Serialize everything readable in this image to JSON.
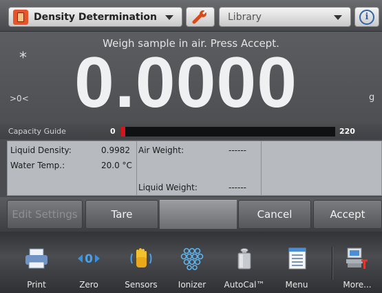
{
  "header": {
    "application": "Density Determination",
    "library_placeholder": "Library",
    "info_glyph": "i"
  },
  "display": {
    "prompt": "Weigh sample in air. Press Accept.",
    "stable_indicator": "*",
    "zero_indicator": ">0<",
    "weight": "0.0000",
    "unit": "g"
  },
  "capacity": {
    "label": "Capacity Guide",
    "min": "0",
    "max": "220",
    "fill_fraction": 0.02,
    "fill_color": "#d8141a"
  },
  "info": {
    "liquid_density_label": "Liquid Density:",
    "liquid_density_value": "0.9982",
    "water_temp_label": "Water Temp.:",
    "water_temp_value": "20.0 °C",
    "air_weight_label": "Air Weight:",
    "air_weight_value": "------",
    "liquid_weight_label": "Liquid Weight:",
    "liquid_weight_value": "------"
  },
  "actions": {
    "edit_settings": "Edit Settings",
    "tare": "Tare",
    "cancel": "Cancel",
    "accept": "Accept"
  },
  "toolbar": [
    {
      "label": "Print",
      "icon": "printer-icon"
    },
    {
      "label": "Zero",
      "icon": "zero-icon"
    },
    {
      "label": "Sensors",
      "icon": "hand-sensor-icon"
    },
    {
      "label": "Ionizer",
      "icon": "ionizer-icon"
    },
    {
      "label": "AutoCal™",
      "icon": "calibration-weight-icon"
    },
    {
      "label": "Menu",
      "icon": "menu-list-icon"
    },
    {
      "label": "More...",
      "icon": "more-scale-icon"
    }
  ]
}
